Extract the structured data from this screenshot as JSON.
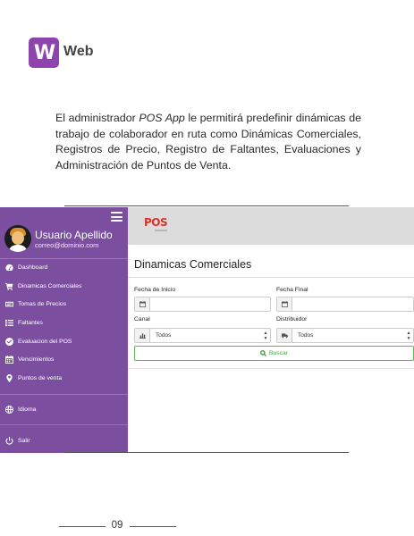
{
  "header": {
    "logo_letter": "W",
    "label": "Web",
    "brand_color": "#8e44ad"
  },
  "intro": {
    "before": "El administrador ",
    "app_name": "POS App",
    "after": " le permitirá predefinir dinámicas de trabajo de colaborador en ruta como Dinámicas Comerciales, Registros de Precio, Registro de Faltantes, Evaluaciones y Administración de Puntos de Venta."
  },
  "screenshot": {
    "sidebar": {
      "color": "#7b4ea0",
      "user_name": "Usuario Apellido",
      "user_email": "correo@dominio.com",
      "items": [
        {
          "label": "Dashboard",
          "icon": "dashboard-icon"
        },
        {
          "label": "Dinamicas Comerciales",
          "icon": "cart-icon"
        },
        {
          "label": "Tomas de Precios",
          "icon": "price-tag-icon"
        },
        {
          "label": "Faltantes",
          "icon": "list-icon"
        },
        {
          "label": "Evaluacion del POS",
          "icon": "check-circle-icon"
        },
        {
          "label": "Vencimientos",
          "icon": "calendar-icon"
        },
        {
          "label": "Puntos de venta",
          "icon": "map-marker-icon"
        }
      ],
      "language_label": "Idioma",
      "logout_label": "Salir"
    },
    "topbar": {
      "logo_text": "POS"
    },
    "page_title": "Dinamicas Comerciales",
    "form": {
      "fecha_inicio_label": "Fecha de Inicio",
      "fecha_inicio_value": "",
      "fecha_final_label": "Fecha Final",
      "fecha_final_value": "",
      "canal_label": "Canal",
      "canal_value": "Todos",
      "distribuidor_label": "Distribuidor",
      "distribuidor_value": "Todos",
      "search_label": "Buscar",
      "search_color": "#5cb85c"
    }
  },
  "footer": {
    "page_number": "09"
  }
}
